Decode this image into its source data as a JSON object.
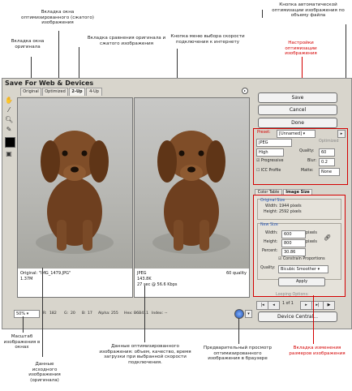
{
  "annotations": {
    "optimized_tab": "Вкладка окна оптимизированного (сжатого) изображения",
    "original_tab": "Вкладка окна оригинала",
    "compare_tab": "Вкладка сравнения оригинала и сжатого изображения",
    "speed_menu": "Кнопка меню выбора скорости подключения к интернету",
    "auto_optimize": "Кнопка автоматической оптимизации изображения по объему файла",
    "settings": "Настройки оптимизации изображения",
    "zoom": "Масштаб изображения в окнах",
    "original_data": "Данные исходного изображения (оригинала)",
    "optimized_data": "Данные оптимизированного изображения: объем, качество, время загрузки при выбранной скорости подключения.",
    "preview": "Предварительный просмотр оптимизированного изображения в браузере",
    "size_tab": "Вкладка изменения размеров изображения"
  },
  "window": {
    "title": "Save For Web & Devices",
    "tabs": [
      "Original",
      "Optimized",
      "2-Up",
      "4-Up"
    ],
    "active_tab": "2-Up"
  },
  "panes": {
    "left": {
      "line1": "Original: \"IMG_1479.JPG\"",
      "line2": "1.37M"
    },
    "right": {
      "line1": "JPEG",
      "line2": "143.8K",
      "line3": "27 sec @ 56.6 Kbps",
      "quality": "60 quality"
    }
  },
  "buttons": {
    "save": "Save",
    "cancel": "Cancel",
    "done": "Done",
    "device_central": "Device Central...",
    "apply": "Apply"
  },
  "settings": {
    "preset_label": "Preset:",
    "preset_value": "[Unnamed]",
    "format": "JPEG",
    "optimized": "Optimized",
    "compression": "High",
    "quality_label": "Quality:",
    "quality_value": "60",
    "progressive": "Progressive",
    "blur_label": "Blur:",
    "blur_value": "0.2",
    "icc": "ICC Profile",
    "matte_label": "Matte:",
    "matte_value": "None"
  },
  "subtabs": [
    "Color Table",
    "Image Size"
  ],
  "image_size": {
    "original_title": "Original Size",
    "orig_width": "Width: 1944 pixels",
    "orig_height": "Height: 2592 pixels",
    "new_title": "New Size",
    "width_label": "Width:",
    "width_value": "600",
    "height_label": "Height:",
    "height_value": "800",
    "percent_label": "Percent:",
    "percent_value": "30.86",
    "unit": "pixels",
    "constrain": "Constrain Proportions",
    "quality_label": "Quality:",
    "quality_value": "Bicubic Smoother"
  },
  "looping": {
    "label": "Looping Options:",
    "frame": "1 of 1"
  },
  "bottom": {
    "zoom": "50%",
    "r": "R:",
    "r_val": "182",
    "g": "G:",
    "g_val": "20",
    "b": "B:",
    "b_val": "17",
    "alpha": "Alpha:",
    "alpha_val": "255",
    "hex": "Hex:",
    "hex_val": "B6B411",
    "index": "Index:",
    "index_val": "--"
  },
  "colors": {
    "accent": "#d40000",
    "window_bg": "#d8d5cc",
    "puppy": "#7a4a27"
  }
}
